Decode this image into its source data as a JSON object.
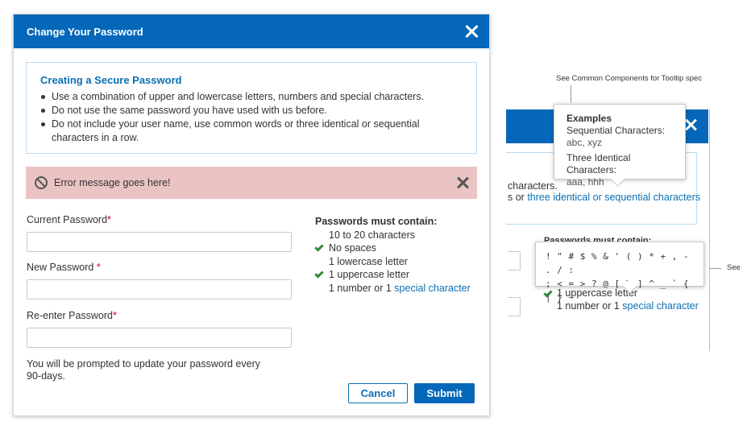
{
  "modal": {
    "title": "Change Your Password",
    "info": {
      "title": "Creating a Secure Password",
      "items": [
        "Use a combination of upper and lowercase letters, numbers and special characters.",
        "Do not use the same password you have used with us before.",
        "Do not include your user name, use common words or three identical or sequential characters in a row."
      ]
    },
    "error": "Error message goes here!",
    "fields": {
      "current_label": "Current Password",
      "new_label": "New Password",
      "reenter_label": "Re-enter Password",
      "required_mark": "*"
    },
    "rules": {
      "title": "Passwords must contain:",
      "items": [
        {
          "text": "10 to 20 characters",
          "checked": false
        },
        {
          "text": "No spaces",
          "checked": true
        },
        {
          "text": "1 lowercase letter",
          "checked": false
        },
        {
          "text": "1 uppercase letter",
          "checked": true
        },
        {
          "text": "1 number or 1 ",
          "link": "special character",
          "checked": false
        }
      ]
    },
    "note": "You will be prompted to update your password every 90-days.",
    "cancel_label": "Cancel",
    "submit_label": "Submit"
  },
  "spec": {
    "tooltip_note": "See Common Components for Tooltip spec",
    "see_label": "See",
    "side_text_1": "characters.",
    "side_text_2_prefix": "s or ",
    "side_text_2_link": "three identical or sequential characters",
    "side_rules_title": "Passwords must contain:",
    "side_rule_1": "1 uppercase letter",
    "side_rule_2_prefix": "1 number or 1 ",
    "side_rule_2_link": "special character",
    "examples_tooltip": {
      "title": "Examples",
      "seq_label": "Sequential Characters:",
      "seq_value": "abc, xyz",
      "ident_label": "Three Identical Characters:",
      "ident_value": "aaa, hhh"
    },
    "chars_tooltip": {
      "line1": "! \" # $ % & ' ( ) * + , - . / :",
      "line2": "; < = > ? @ [ \\ ] ^ _ ` { | } ~"
    }
  },
  "colors": {
    "header_blue": "#0467b9",
    "link_blue": "#0c6fb4",
    "error_bg": "#eac4c3",
    "check_green": "#2e8b3a",
    "required_red": "#d0021b"
  }
}
